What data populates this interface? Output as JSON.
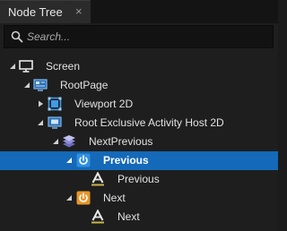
{
  "tab": {
    "title": "Node Tree",
    "close": "×"
  },
  "search": {
    "placeholder": "Search..."
  },
  "tree": {
    "nodes": [
      {
        "label": "Screen",
        "icon": "monitor-icon",
        "expanded": true
      },
      {
        "label": "RootPage",
        "icon": "page-icon",
        "expanded": true
      },
      {
        "label": "Viewport 2D",
        "icon": "viewport-icon",
        "expanded": false
      },
      {
        "label": "Root Exclusive Activity Host 2D",
        "icon": "host-icon",
        "expanded": true
      },
      {
        "label": "NextPrevious",
        "icon": "layers-icon",
        "expanded": true
      },
      {
        "label": "Previous",
        "icon": "power-button-icon",
        "expanded": true,
        "selected": true
      },
      {
        "label": "Previous",
        "icon": "text-block-icon"
      },
      {
        "label": "Next",
        "icon": "power-button-icon",
        "expanded": true
      },
      {
        "label": "Next",
        "icon": "text-block-icon"
      }
    ]
  },
  "colors": {
    "selection": "#1469b8",
    "button_blue": "#2f8fe0",
    "button_orange": "#e8952b",
    "text_icon_yellow": "#c9b54a"
  }
}
